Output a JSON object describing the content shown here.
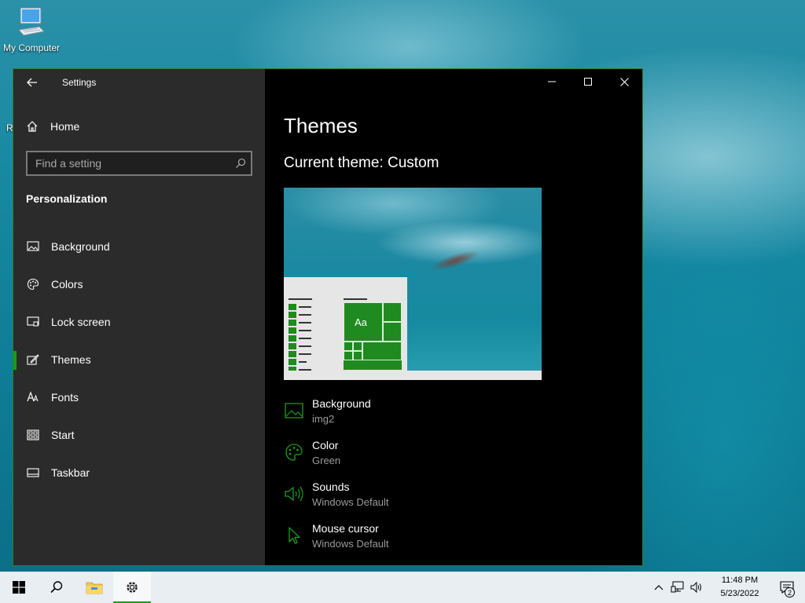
{
  "desktop": {
    "icon_label": "My Computer",
    "partial_icon_label": "R"
  },
  "window": {
    "app_title": "Settings",
    "home_label": "Home",
    "search_placeholder": "Find a setting",
    "section_title": "Personalization",
    "nav_items": [
      {
        "label": "Background",
        "icon": "picture-icon"
      },
      {
        "label": "Colors",
        "icon": "palette-icon"
      },
      {
        "label": "Lock screen",
        "icon": "lock-screen-icon"
      },
      {
        "label": "Themes",
        "icon": "brush-icon",
        "active": true
      },
      {
        "label": "Fonts",
        "icon": "font-icon"
      },
      {
        "label": "Start",
        "icon": "start-icon"
      },
      {
        "label": "Taskbar",
        "icon": "taskbar-icon"
      }
    ]
  },
  "content": {
    "page_title": "Themes",
    "current_theme": "Current theme: Custom",
    "preview": {
      "tile_text": "Aa"
    },
    "properties": [
      {
        "label": "Background",
        "value": "img2",
        "icon": "picture-icon"
      },
      {
        "label": "Color",
        "value": "Green",
        "icon": "palette-icon"
      },
      {
        "label": "Sounds",
        "value": "Windows Default",
        "icon": "speaker-icon"
      },
      {
        "label": "Mouse cursor",
        "value": "Windows Default",
        "icon": "cursor-icon"
      }
    ]
  },
  "taskbar": {
    "time": "11:48 PM",
    "date": "5/23/2022",
    "notification_count": "2"
  },
  "colors": {
    "accent": "#1a9c1a",
    "sidebar_bg": "#2b2b2b",
    "content_bg": "#000000",
    "taskbar_bg": "#e8eef2"
  }
}
